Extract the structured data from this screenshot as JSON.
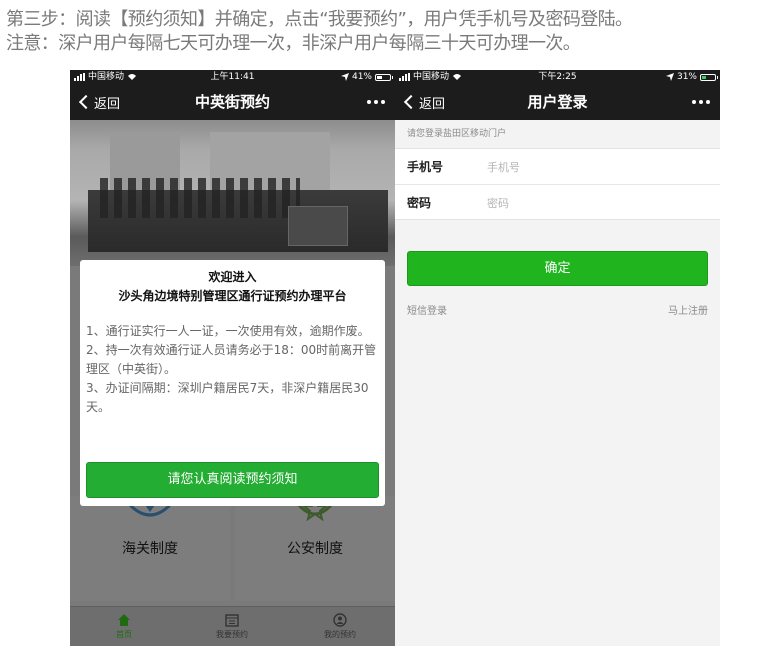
{
  "instructions": {
    "line1": "第三步：阅读【预约须知】并确定，点击“我要预约”，用户凭手机号及密码登陆。",
    "line2": "注意：深户用户每隔七天可办理一次，非深户用户每隔三十天可办理一次。"
  },
  "left_phone": {
    "status": {
      "carrier": "中国移动",
      "time": "上午11:41",
      "battery": "41%",
      "battery_level": 0.41
    },
    "nav": {
      "back": "返回",
      "title": "中英街预约"
    },
    "modal": {
      "title_line1": "欢迎进入",
      "title_line2": "沙头角边境特别管理区通行证预约办理平台",
      "rule1": "1、通行证实行一人一证，一次使用有效，逾期作废。",
      "rule2": "2、持一次有效通行证人员请务必于18：00时前离开管理区（中英街）。",
      "rule3": "3、办证间隔期：深圳户籍居民7天，非深户籍居民30天。",
      "button": "请您认真阅读预约须知"
    },
    "tiles": {
      "customs": "海关制度",
      "police": "公安制度"
    },
    "tabs": {
      "home": "首页",
      "book": "我要预约",
      "mine": "我的预约"
    }
  },
  "right_phone": {
    "status": {
      "carrier": "中国移动",
      "time": "下午2:25",
      "battery": "31%",
      "battery_level": 0.31
    },
    "nav": {
      "back": "返回",
      "title": "用户登录"
    },
    "login": {
      "hint": "请您登录盐田区移动门户",
      "phone_label": "手机号",
      "phone_placeholder": "手机号",
      "password_label": "密码",
      "password_placeholder": "密码",
      "confirm": "确定",
      "sms_login": "短信登录",
      "register": "马上注册"
    }
  },
  "colors": {
    "primary_green": "#24ad33",
    "nav_dark": "#1c1c1c"
  },
  "icons": [
    "wifi-icon",
    "location-icon",
    "battery-icon",
    "back-chevron-icon",
    "more-dots-icon",
    "home-icon",
    "calendar-icon",
    "user-icon"
  ]
}
